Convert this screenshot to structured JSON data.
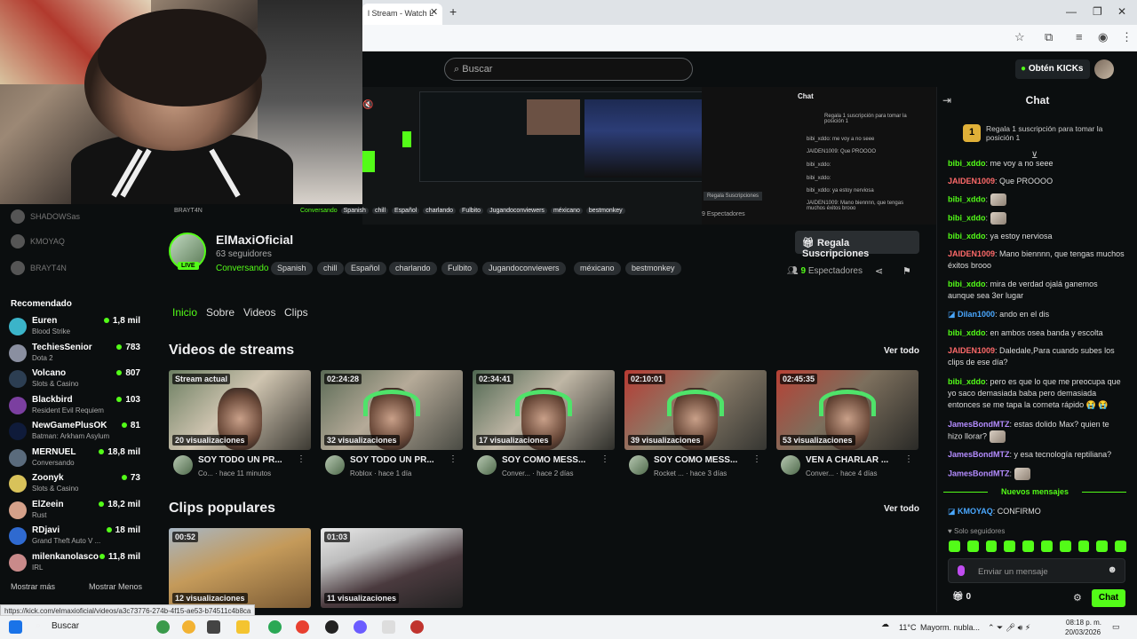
{
  "browser": {
    "tab_title": "l Stream - Watch L",
    "tab_close": "✕",
    "new_tab": "+",
    "min": "—",
    "max": "❐",
    "close": "✕"
  },
  "header": {
    "search_placeholder": "Buscar",
    "get_kicks": "Obtén KICKs"
  },
  "preview": {
    "chat_title": "Chat",
    "chat_lines": [
      "Regala 1 suscripción para tomar la posición 1",
      "bibi_xddo: me voy a no seee",
      "JAIDEN1009: Que PROOOO",
      "bibi_xddo:",
      "bibi_xddo:",
      "bibi_xddo: ya estoy nerviosa",
      "JAIDEN1009: Mano biennnn, que tengas muchos éxitos brooo"
    ],
    "gift_label": "Regala Suscripciones",
    "viewers": "9 Espectadores",
    "mini_channel": "BRAYT4N",
    "mini_tags": [
      "Conversando",
      "Spanish",
      "chill",
      "Español",
      "charlando",
      "Fulbito",
      "Jugandoconviewers",
      "méxicano",
      "bestmonkey"
    ]
  },
  "sidebar": {
    "offline": [
      {
        "name": "SHADOWSas"
      },
      {
        "name": "KMOYAQ"
      },
      {
        "name": "BRAYT4N"
      }
    ],
    "recommended_title": "Recomendado",
    "recommended": [
      {
        "name": "Euren",
        "category": "Blood Strike",
        "viewers": "1,8 mil",
        "color": "#3bb4c9"
      },
      {
        "name": "TechiesSenior",
        "category": "Dota 2",
        "viewers": "783",
        "color": "#8a8fa0"
      },
      {
        "name": "Volcano",
        "category": "Slots & Casino",
        "viewers": "807",
        "color": "#2c3e52"
      },
      {
        "name": "Blackbird",
        "category": "Resident Evil Requiem",
        "viewers": "103",
        "color": "#7b3fa0"
      },
      {
        "name": "NewGamePlusOK",
        "category": "Batman: Arkham Asylum",
        "viewers": "81",
        "color": "#0f1b3a"
      },
      {
        "name": "MERNUEL",
        "category": "Conversando",
        "viewers": "18,8 mil",
        "color": "#5a6b7c"
      },
      {
        "name": "Zoonyk",
        "category": "Slots & Casino",
        "viewers": "73",
        "color": "#d8c25a"
      },
      {
        "name": "ElZeein",
        "category": "Rust",
        "viewers": "18,2 mil",
        "color": "#d5a18a"
      },
      {
        "name": "RDjavi",
        "category": "Grand Theft Auto V ...",
        "viewers": "18 mil",
        "color": "#2f6ad0"
      },
      {
        "name": "milenkanolasco",
        "category": "IRL",
        "viewers": "11,8 mil",
        "color": "#c98a8a"
      }
    ],
    "show_more": "Mostrar más",
    "show_less": "Mostrar Menos"
  },
  "channel": {
    "name": "ElMaxiOficial",
    "followers": "63 seguidores",
    "live_label": "LIVE",
    "category": "Conversando",
    "tags": [
      "Spanish",
      "chill",
      "Español",
      "charlando",
      "Fulbito",
      "Jugandoconviewers",
      "méxicano",
      "bestmonkey"
    ],
    "gift_button": "Regala Suscripciones",
    "viewers_count": "9",
    "viewers_label": "Espectadores"
  },
  "nav_tabs": [
    "Inicio",
    "Sobre",
    "Videos",
    "Clips"
  ],
  "videos_section": {
    "title": "Videos de streams",
    "see_all": "Ver todo",
    "items": [
      {
        "badge": "Stream actual",
        "views": "20 visualizaciones",
        "title": "SOY TODO UN PR...",
        "sub": "Co... · hace 11 minutos"
      },
      {
        "badge": "02:24:28",
        "views": "32 visualizaciones",
        "title": "SOY TODO UN PR...",
        "sub": "Roblox · hace 1 día"
      },
      {
        "badge": "02:34:41",
        "views": "17 visualizaciones",
        "title": "SOY COMO MESS...",
        "sub": "Conver... · hace 2 días"
      },
      {
        "badge": "02:10:01",
        "views": "39 visualizaciones",
        "title": "SOY COMO MESS...",
        "sub": "Rocket ... · hace 3 días"
      },
      {
        "badge": "02:45:35",
        "views": "53 visualizaciones",
        "title": "VEN A CHARLAR ...",
        "sub": "Conver... · hace 4 días"
      }
    ]
  },
  "clips_section": {
    "title": "Clips populares",
    "see_all": "Ver todo",
    "items": [
      {
        "badge": "00:52",
        "views": "12 visualizaciones"
      },
      {
        "badge": "01:03",
        "views": "11 visualizaciones"
      }
    ]
  },
  "chat": {
    "title": "Chat",
    "sub_prompt": "Regala 1 suscripción para tomar la posición 1",
    "crest_number": "1",
    "messages": [
      {
        "user": "bibi_xddo",
        "color": "#53fc18",
        "text": "me voy a no seee"
      },
      {
        "user": "JAIDEN1009",
        "color": "#ff6a6a",
        "text": "Que PROOOO"
      },
      {
        "user": "bibi_xddo",
        "color": "#53fc18",
        "text": "",
        "emote": true
      },
      {
        "user": "bibi_xddo",
        "color": "#53fc18",
        "text": "",
        "emote": true
      },
      {
        "user": "bibi_xddo",
        "color": "#53fc18",
        "text": "ya estoy nerviosa"
      },
      {
        "user": "JAIDEN1009",
        "color": "#ff6a6a",
        "text": "Mano biennnn, que tengas muchos éxitos brooo"
      },
      {
        "user": "bibi_xddo",
        "color": "#53fc18",
        "text": "mira de verdad ojalá ganemos aunque sea 3er lugar"
      },
      {
        "user": "Dilan1000",
        "color": "#4aa8ff",
        "text": "ando en el dis"
      },
      {
        "user": "bibi_xddo",
        "color": "#53fc18",
        "text": "en ambos osea banda y escolta"
      },
      {
        "user": "JAIDEN1009",
        "color": "#ff6a6a",
        "text": "Daledale,Para cuando subes los clips de ese día?"
      },
      {
        "user": "bibi_xddo",
        "color": "#53fc18",
        "text": "pero es que lo que me preocupa que yo saco demasiada baba pero demasiada entonces se me tapa la corneta rápido 😭 😭"
      },
      {
        "user": "JamesBondMTZ",
        "color": "#b48cff",
        "text": "estas dolido Max? quien te hizo llorar?",
        "emote": true
      },
      {
        "user": "JamesBondMTZ",
        "color": "#b48cff",
        "text": "y esa tecnología reptiliana?"
      },
      {
        "user": "JamesBondMTZ",
        "color": "#b48cff",
        "text": "",
        "emote": true
      }
    ],
    "new_messages": "Nuevos mensajes",
    "latest": {
      "user": "KMOYAQ",
      "color": "#53fc18",
      "text": "CONFIRMO"
    },
    "followers_only": "Solo seguidores",
    "input_placeholder": "Enviar un mensaje",
    "kicks_count": "0",
    "send_button": "Chat"
  },
  "status_url": "https://kick.com/elmaxioficial/videos/a3c73776-274b-4f15-ae53-b74511c4b8ca",
  "taskbar": {
    "search": "Buscar",
    "temp": "11°C",
    "weather": "Mayorm. nubla...",
    "time": "08:18 p. m.",
    "date": "20/03/2026"
  }
}
